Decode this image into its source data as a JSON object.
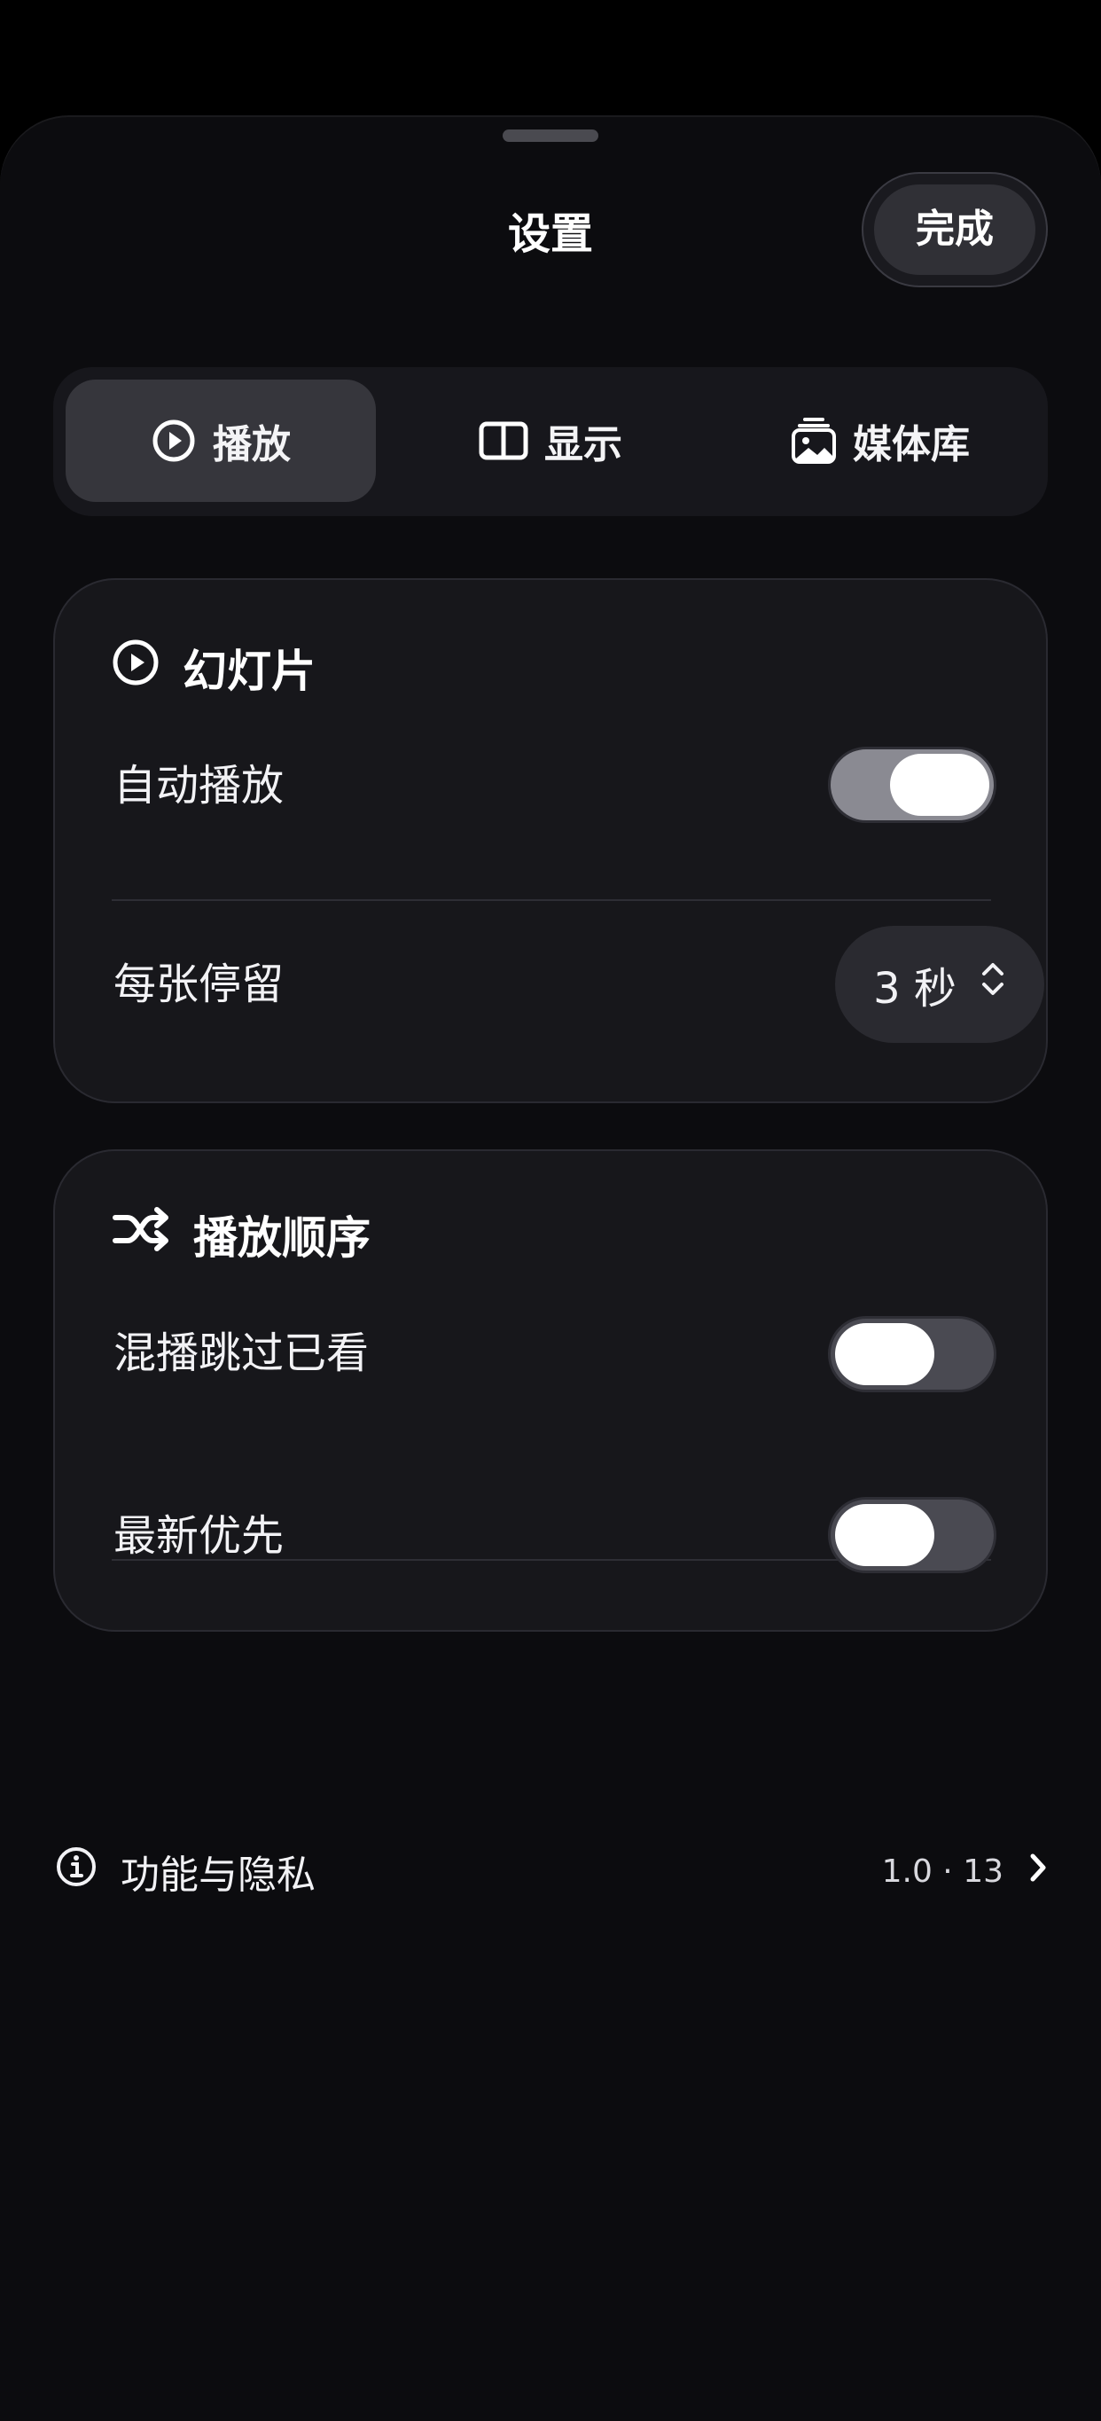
{
  "header": {
    "title": "设置",
    "done_label": "完成"
  },
  "tabs": [
    {
      "label": "播放",
      "icon": "play-circle-icon",
      "active": true
    },
    {
      "label": "显示",
      "icon": "split-view-icon",
      "active": false
    },
    {
      "label": "媒体库",
      "icon": "photo-stack-icon",
      "active": false
    }
  ],
  "slideshow": {
    "title": "幻灯片",
    "icon": "play-circle-icon",
    "autoplay": {
      "label": "自动播放",
      "on": true
    },
    "duration": {
      "label": "每张停留",
      "value": "3 秒"
    }
  },
  "order": {
    "title": "播放顺序",
    "icon": "shuffle-icon",
    "skip_seen": {
      "label": "混播跳过已看",
      "on": false
    },
    "newest_first": {
      "label": "最新优先",
      "on": false
    }
  },
  "footer": {
    "label": "功能与隐私",
    "icon": "info-icon",
    "version": "1.0 · 13"
  },
  "colors": {
    "background": "#0c0c0f",
    "card": "#17171b",
    "toggle_on": "#8a8a92",
    "toggle_off": "#4a4a52"
  }
}
